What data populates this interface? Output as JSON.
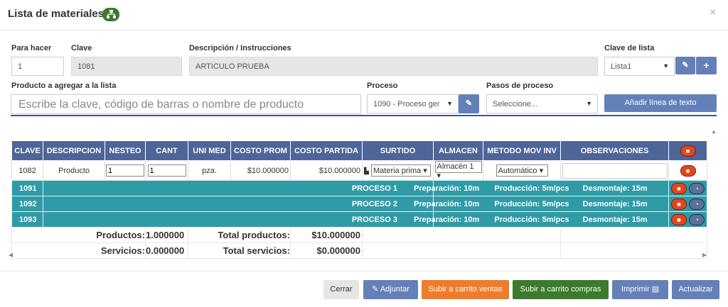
{
  "modal": {
    "title": "Lista de materiales",
    "close_label": "×"
  },
  "form": {
    "para_hacer_label": "Para hacer",
    "para_hacer_value": "1",
    "clave_label": "Clave",
    "clave_value": "1081",
    "descripcion_label": "Descripción / Instrucciones",
    "descripcion_value": "ARTICULO PRUEBA",
    "clave_lista_label": "Clave de lista",
    "clave_lista_value": "Lista1",
    "producto_label": "Producto a agregar a la lista",
    "producto_placeholder": "Escribe la clave, código de barras o nombre de producto",
    "proceso_label": "Proceso",
    "proceso_value": "1090 - Proceso ger",
    "pasos_label": "Pasos de proceso",
    "pasos_value": "Seleccione...",
    "add_text_line_label": "Añadir línea de texto"
  },
  "table": {
    "headers": [
      "CLAVE",
      "DESCRIPCION",
      "NESTEO",
      "CANT",
      "UNI MED",
      "COSTO PROM",
      "COSTO PARTIDA",
      "SURTIDO",
      "ALMACEN",
      "METODO MOV INV",
      "OBSERVACIONES"
    ],
    "item": {
      "clave": "1082",
      "descripcion": "Producto",
      "nesteo": "1",
      "cant": "1",
      "uni_med": "pza.",
      "costo_prom": "$10.000000",
      "costo_partida": "$10.000000",
      "surtido": "Materia prima",
      "almacen": "Almacén 1",
      "metodo": "Automático",
      "observaciones": ""
    },
    "processes": [
      {
        "clave": "1091",
        "name": "PROCESO 1",
        "prep": "Preparación: 10m",
        "prod": "Producción: 5m/pcs",
        "desm": "Desmontaje: 15m"
      },
      {
        "clave": "1092",
        "name": "PROCESO 2",
        "prep": "Preparación: 10m",
        "prod": "Producción: 5m/pcs",
        "desm": "Desmontaje: 15m"
      },
      {
        "clave": "1093",
        "name": "PROCESO 3",
        "prep": "Preparación: 10m",
        "prod": "Producción: 5m/pcs",
        "desm": "Desmontaje: 15m"
      }
    ],
    "totals": {
      "productos_label": "Productos:",
      "productos_value": "1.000000",
      "total_productos_label": "Total productos:",
      "total_productos_value": "$10.000000",
      "servicios_label": "Servicios:",
      "servicios_value": "0.000000",
      "total_servicios_label": "Total servicios:",
      "total_servicios_value": "$0.000000"
    }
  },
  "footer": {
    "cerrar": "Cerrar",
    "adjuntar": "Adjuntar",
    "carrito_ventas": "Subir a carrito ventas",
    "carrito_compras": "Subir a carrito compras",
    "imprimir": "Imprimir",
    "actualizar": "Actualizar"
  },
  "colors": {
    "header_blue": "#4e6598",
    "process_teal": "#2e9ba7",
    "orange": "#ee7d2b",
    "green": "#3c7a2c",
    "delete_red": "#e0481f"
  }
}
